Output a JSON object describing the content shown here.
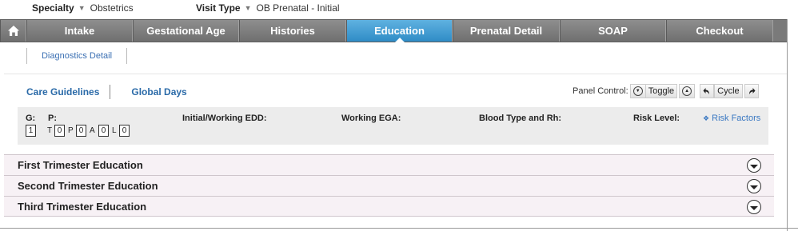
{
  "header": {
    "specialty_label": "Specialty",
    "specialty_value": "Obstetrics",
    "visit_type_label": "Visit Type",
    "visit_type_value": "OB Prenatal - Initial"
  },
  "tabs": [
    {
      "label": "Intake"
    },
    {
      "label": "Gestational Age"
    },
    {
      "label": "Histories"
    },
    {
      "label": "Education"
    },
    {
      "label": "Prenatal Detail"
    },
    {
      "label": "SOAP"
    },
    {
      "label": "Checkout"
    }
  ],
  "subtab": {
    "label": "Diagnostics Detail"
  },
  "links": {
    "care_guidelines": "Care Guidelines",
    "global_days": "Global Days"
  },
  "panel_control": {
    "label": "Panel Control:",
    "toggle": "Toggle",
    "cycle": "Cycle"
  },
  "summary": {
    "g_label": "G:",
    "p_label": "P:",
    "g_value": "1",
    "t_letter": "T",
    "t_value": "0",
    "p_letter": "P",
    "p_value": "0",
    "a_letter": "A",
    "a_value": "0",
    "l_letter": "L",
    "l_value": "0",
    "edd_label": "Initial/Working EDD:",
    "ega_label": "Working EGA:",
    "blood_label": "Blood Type and Rh:",
    "risk_label": "Risk Level:",
    "risk_factors": "Risk Factors"
  },
  "sections": [
    {
      "title": "First Trimester Education"
    },
    {
      "title": "Second Trimester Education"
    },
    {
      "title": "Third Trimester Education"
    }
  ],
  "colors": {
    "active_tab": "#3b98d3",
    "tab_bg": "#7a7a7a",
    "link": "#2a6aa8",
    "section_bg": "#f7f1f5"
  }
}
